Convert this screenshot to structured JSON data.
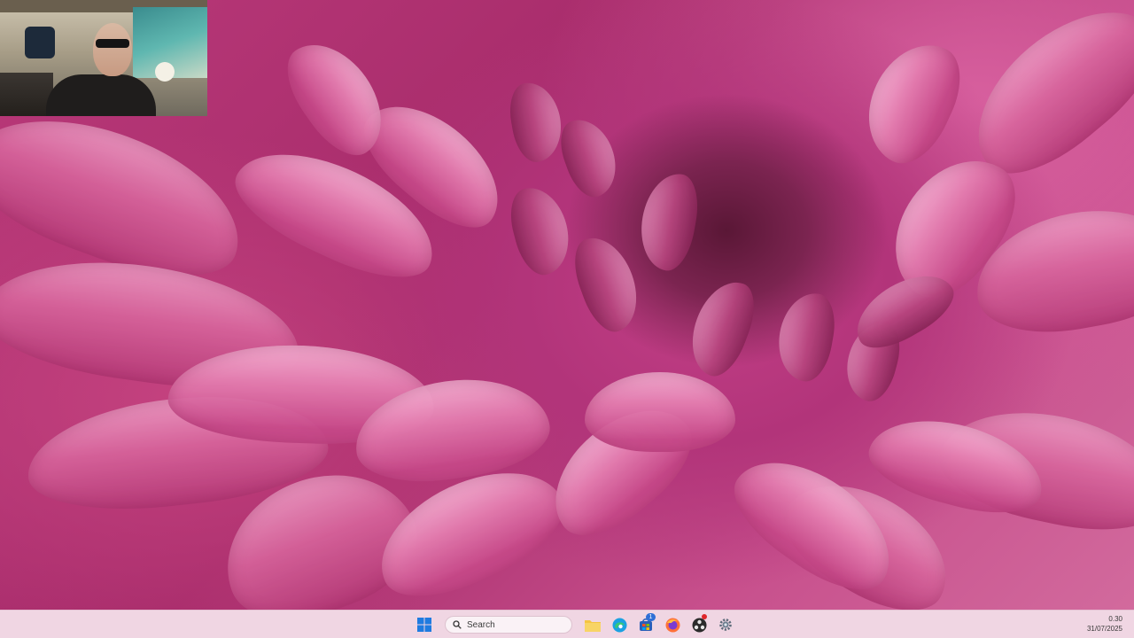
{
  "taskbar": {
    "search_placeholder": "Search",
    "icons": {
      "start": "windows-start-icon",
      "search": "search-icon",
      "file_explorer": "folder-icon",
      "edge": "edge-browser-icon",
      "store": "store-icon",
      "firefox": "firefox-icon",
      "obs": "obs-studio-icon",
      "settings": "gear-icon"
    },
    "store_badge": "1",
    "clock": {
      "time": "0.30",
      "date": "31/07/2025"
    }
  },
  "colors": {
    "taskbar_bg": "#f0d6e3",
    "wallpaper_primary": "#c23f86",
    "badge_blue": "#2f6fd6",
    "notification_red": "#e0262b"
  }
}
